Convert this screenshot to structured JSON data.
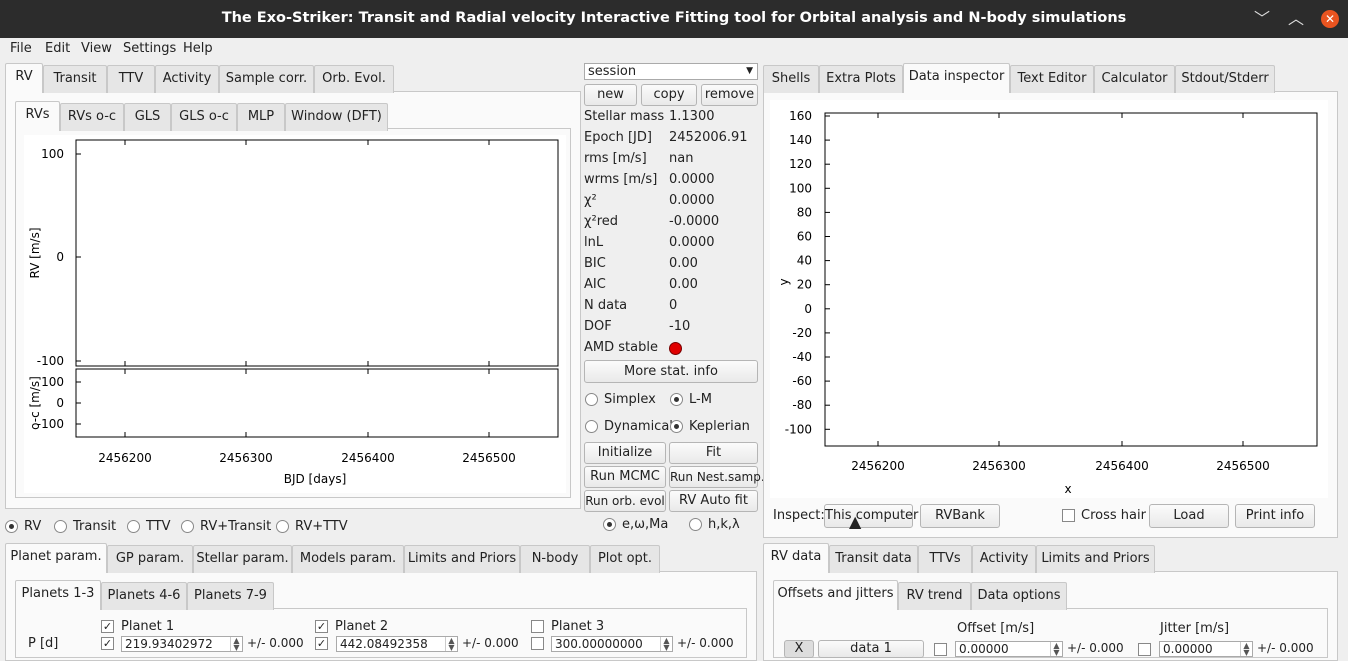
{
  "window": {
    "title": "The Exo-Striker:  Transit and Radial velocity Interactive Fitting tool for Orbital analysis and N-body simulations",
    "minimize": "﹀",
    "maximize": "︿",
    "close": "✕"
  },
  "menu": [
    "File",
    "Edit",
    "View",
    "Settings",
    "Help"
  ],
  "left_tabs": [
    "RV",
    "Transit",
    "TTV",
    "Activity",
    "Sample corr.",
    "Orb. Evol."
  ],
  "rv_subtabs": [
    "RVs",
    "RVs o-c",
    "GLS",
    "GLS o-c",
    "MLP",
    "Window (DFT)"
  ],
  "rv_plot": {
    "ylabel": "RV [m/s]",
    "yticks": [
      "100",
      "0",
      "-100"
    ],
    "oc_ylabel": "o-c [m/s]",
    "oc_yticks": [
      "100",
      "0",
      "-100"
    ],
    "xticks": [
      "2456200",
      "2456300",
      "2456400",
      "2456500"
    ],
    "xlabel": "BJD [days]"
  },
  "session": {
    "select_value": "session",
    "new": "new",
    "copy": "copy",
    "remove": "remove"
  },
  "stats": [
    {
      "label": "Stellar mass",
      "value": "1.1300"
    },
    {
      "label": "Epoch [JD]",
      "value": "2452006.91"
    },
    {
      "label": "rms [m/s]",
      "value": "nan"
    },
    {
      "label": "wrms [m/s]",
      "value": "0.0000"
    },
    {
      "label": "χ²",
      "value": "0.0000"
    },
    {
      "label": "χ²red",
      "value": "-0.0000"
    },
    {
      "label": "lnL",
      "value": "0.0000"
    },
    {
      "label": "BIC",
      "value": "0.00"
    },
    {
      "label": "AIC",
      "value": "0.00"
    },
    {
      "label": "N data",
      "value": "0"
    },
    {
      "label": "DOF",
      "value": "-10"
    },
    {
      "label": "AMD stable",
      "value": ""
    }
  ],
  "amd_color": "#e00000",
  "more_stat": "More stat. info",
  "fit_options": {
    "simplex": "Simplex",
    "lm": "L-M",
    "dynamical": "Dynamical",
    "keplerian": "Keplerian"
  },
  "actions": {
    "initialize": "Initialize",
    "fit": "Fit",
    "run_mcmc": "Run MCMC",
    "run_nest": "Run Nest.samp.",
    "run_orb": "Run orb. evol",
    "rv_autofit": "RV Auto fit"
  },
  "param_mode": {
    "ewma": "e,ω,Ma",
    "hkl": "h,k,λ"
  },
  "fit_mode": [
    "RV",
    "Transit",
    "TTV",
    "RV+Transit",
    "RV+TTV"
  ],
  "right_tabs": [
    "Shells",
    "Extra Plots",
    "Data inspector",
    "Text Editor",
    "Calculator",
    "Stdout/Stderr"
  ],
  "inspector_plot": {
    "yticks": [
      "160",
      "140",
      "120",
      "100",
      "80",
      "60",
      "40",
      "20",
      "0",
      "-20",
      "-40",
      "-60",
      "-80",
      "-100"
    ],
    "xticks": [
      "2456200",
      "2456300",
      "2456400",
      "2456500"
    ],
    "xlabel": "x",
    "ylabel": "y"
  },
  "inspect": {
    "label": "Inspect:",
    "this_computer": "This computer",
    "rvbank": "RVBank",
    "cross_hair": "Cross hair",
    "load": "Load",
    "print_info": "Print info"
  },
  "bottom_left_tabs": [
    "Planet param.",
    "GP param.",
    "Stellar param.",
    "Models param.",
    "Limits and Priors",
    "N-body",
    "Plot opt."
  ],
  "planet_subtabs": [
    "Planets 1-3",
    "Planets 4-6",
    "Planets 7-9"
  ],
  "planets": {
    "p_label": "P [d]",
    "names": [
      "Planet 1",
      "Planet 2",
      "Planet 3"
    ],
    "periods": [
      "219.93402972",
      "442.08492358",
      "300.00000000"
    ],
    "errors": [
      "+/- 0.000",
      "+/- 0.000",
      "+/- 0.000"
    ]
  },
  "bottom_right_tabs": [
    "RV data",
    "Transit data",
    "TTVs",
    "Activity",
    "Limits and Priors"
  ],
  "rvdata_subtabs": [
    "Offsets and jitters",
    "RV trend",
    "Data options"
  ],
  "rvdata": {
    "offset_label": "Offset [m/s]",
    "jitter_label": "Jitter [m/s]",
    "x_btn": "X",
    "data1": "data 1",
    "offset_value": "0.00000",
    "jitter_value": "0.00000",
    "err": "+/- 0.000"
  }
}
